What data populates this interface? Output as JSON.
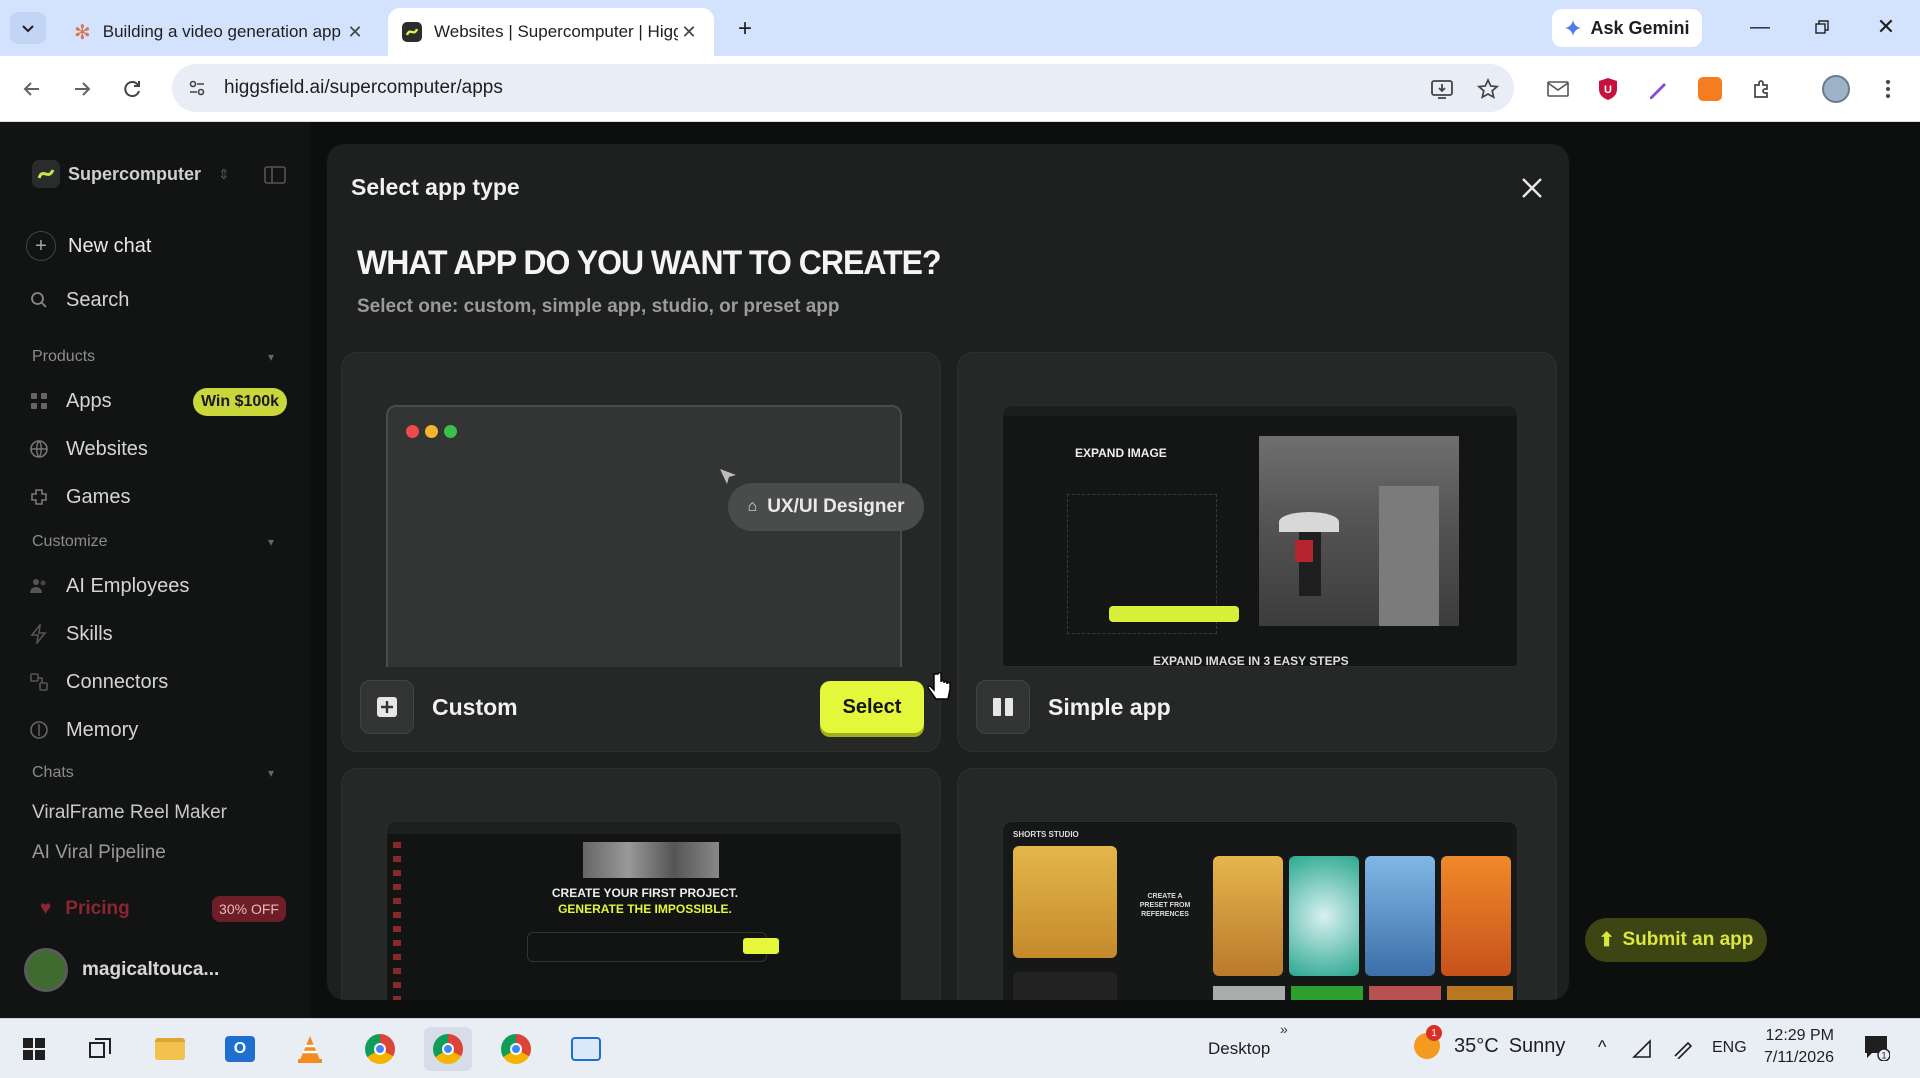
{
  "browser": {
    "tabs": [
      {
        "title": "Building a video generation app",
        "favicon": "claude-icon",
        "active": false
      },
      {
        "title": "Websites | Supercomputer | Higgsfield",
        "favicon": "higgsfield-icon",
        "active": true
      }
    ],
    "ask_gemini": "Ask Gemini",
    "url": "higgsfield.ai/supercomputer/apps"
  },
  "sidebar": {
    "brand": "Supercomputer",
    "new_chat": "New chat",
    "search": "Search",
    "products_label": "Products",
    "products": [
      {
        "label": "Apps",
        "icon": "grid-icon",
        "badge": "Win $100k"
      },
      {
        "label": "Websites",
        "icon": "globe-icon"
      },
      {
        "label": "Games",
        "icon": "gamepad-icon"
      }
    ],
    "customize_label": "Customize",
    "customize": [
      {
        "label": "AI Employees",
        "icon": "people-icon"
      },
      {
        "label": "Skills",
        "icon": "bolt-icon"
      },
      {
        "label": "Connectors",
        "icon": "plug-icon"
      },
      {
        "label": "Memory",
        "icon": "brain-icon"
      }
    ],
    "chats_label": "Chats",
    "chats": [
      "ViralFrame Reel Maker",
      "AI Viral Pipeline"
    ],
    "pricing": "Pricing",
    "pricing_badge": "30% OFF",
    "user": "magicaltouca..."
  },
  "modal": {
    "header": "Select app type",
    "headline": "WHAT APP DO YOU WANT TO CREATE?",
    "subheadline": "Select one: custom, simple app, studio, or preset app",
    "cards": [
      {
        "label": "Custom",
        "button": "Select",
        "badge": "UX/UI Designer"
      },
      {
        "label": "Simple app",
        "preview_title": "EXPAND IMAGE",
        "preview_footer": "EXPAND IMAGE IN 3 EASY STEPS"
      },
      {
        "preview_line1": "CREATE YOUR FIRST PROJECT.",
        "preview_line2": "GENERATE THE IMPOSSIBLE."
      },
      {
        "preview_title": "SHORTS STUDIO",
        "preview_center": "CREATE A PRESET FROM REFERENCES"
      }
    ]
  },
  "submit_app": "Submit an app",
  "taskbar": {
    "desktop": "Desktop",
    "weather_temp": "35°C",
    "weather_text": "Sunny",
    "lang": "ENG",
    "time": "12:29 PM",
    "date": "7/11/2026",
    "notification_count": "1"
  },
  "colors": {
    "accent_yellow": "#e4f73a",
    "tab_bar": "#d3e3fd",
    "pricing_red": "#e0344a"
  }
}
